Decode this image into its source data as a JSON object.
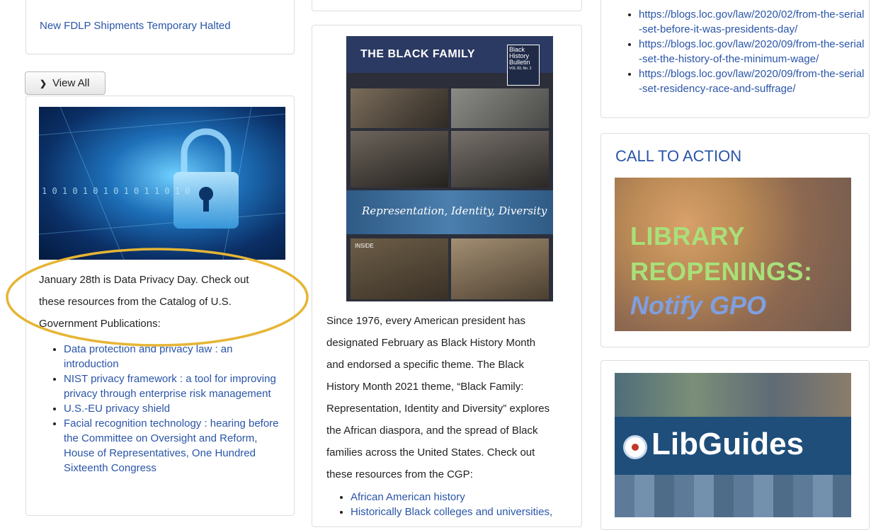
{
  "left_column": {
    "news_item": "New FDLP Shipments Temporary Halted",
    "view_all_label": "View All",
    "privacy_intro": [
      "January 28th is Data Privacy Day. Check out",
      "these resources from the Catalog of U.S.",
      "Government Publications:"
    ],
    "privacy_links": [
      "Data protection and privacy law : an introduction",
      "NIST privacy framework : a tool for improving privacy through enterprise risk management",
      "U.S.-EU privacy shield",
      "Facial recognition technology : hearing before the Committee on Oversight and Reform, House of Representatives, One Hundred Sixteenth Congress"
    ],
    "hero_binary": "1 0 1 0 1 0 1 0 1 0 1 1 0 1 0"
  },
  "middle_column": {
    "poster": {
      "title": "THE BLACK FAMILY",
      "badge": [
        "Black",
        "History",
        "Bulletin"
      ],
      "badge_vol": "VOL 83, No. 2",
      "script_text": "Representation, Identity, Diversity",
      "inside_label": "INSIDE"
    },
    "paragraph_lines": [
      "Since 1976, every American president has",
      "designated February as Black History Month",
      "and endorsed a specific theme. The Black",
      "History Month 2021 theme, “Black Family:",
      "Representation, Identity and Diversity” explores",
      "the African diaspora, and the spread of Black",
      "families across the United States. Check out",
      "these resources from the CGP:"
    ],
    "links": [
      "African American history",
      "Historically Black colleges and universities,"
    ]
  },
  "right_column": {
    "blog_links": [
      "https://blogs.loc.gov/law/2020/02/from-the-serial-set-before-it-was-presidents-day/",
      "https://blogs.loc.gov/law/2020/09/from-the-serial-set-the-history-of-the-minimum-wage/",
      "https://blogs.loc.gov/law/2020/09/from-the-serial-set-residency-race-and-suffrage/"
    ],
    "cta_heading": "CALL TO ACTION",
    "cta_banner": {
      "line1": "LIBRARY",
      "line2": "REOPENINGS:",
      "line3": "Notify GPO"
    },
    "libguides_text": "LibGuides"
  },
  "colors": {
    "link": "#2a55a8",
    "annotation_ellipse": "#e6b535",
    "cta_green": "#a8e07a",
    "cta_blue": "#7f9fe0"
  }
}
